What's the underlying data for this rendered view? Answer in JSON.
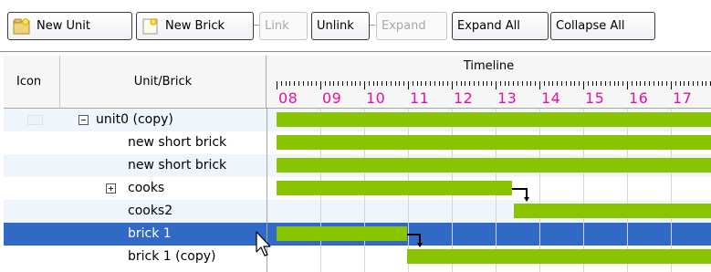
{
  "toolbar": {
    "new_unit": "New Unit",
    "new_brick": "New Brick",
    "link": "Link",
    "unlink": "Unlink",
    "expand": "Expand",
    "expand_all": "Expand All",
    "collapse_all": "Collapse All"
  },
  "columns": {
    "icon": "Icon",
    "unit_brick": "Unit/Brick",
    "timeline": "Timeline"
  },
  "timeline_hours": [
    "08",
    "09",
    "10",
    "11",
    "12",
    "13",
    "14",
    "15",
    "16",
    "17"
  ],
  "rows": [
    {
      "label": "unit0 (copy)",
      "expander": "minus",
      "selected": false
    },
    {
      "label": "new short brick",
      "expander": "none",
      "selected": false
    },
    {
      "label": "new short brick",
      "expander": "none",
      "selected": false
    },
    {
      "label": "cooks",
      "expander": "plus",
      "selected": false
    },
    {
      "label": "cooks2",
      "expander": "none",
      "selected": false
    },
    {
      "label": "brick 1",
      "expander": "none",
      "selected": true
    },
    {
      "label": "brick 1 (copy)",
      "expander": "none",
      "selected": false
    }
  ],
  "colors": {
    "bar": "#88c400",
    "selection": "#3169c6",
    "hour_label": "#e8119a",
    "row_alt": "#eef5fc"
  }
}
